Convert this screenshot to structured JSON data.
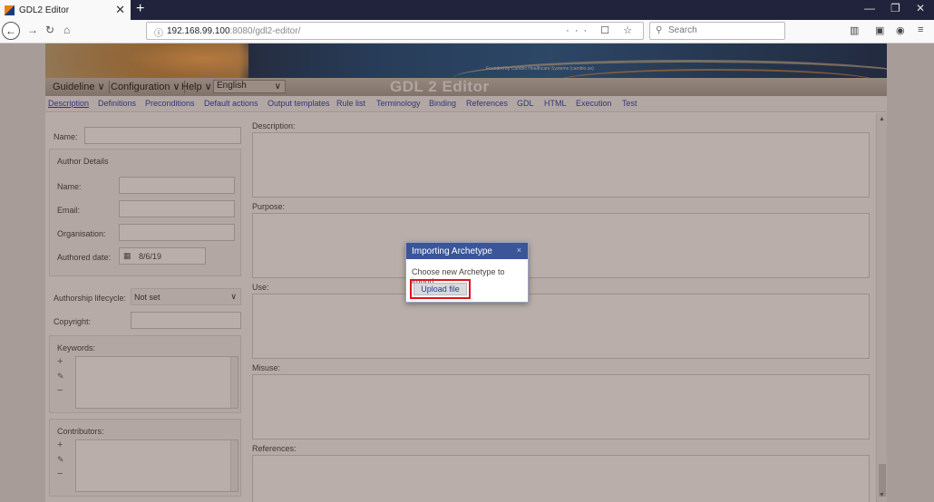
{
  "browser": {
    "tab_title": "GDL2 Editor",
    "tab_close": "✕",
    "new_tab": "+",
    "window_controls": [
      "—",
      "❐",
      "✕"
    ],
    "url_host": "192.168.99.100",
    "url_rest": ":8080/gdl2-editor/",
    "url_actions": "··· ☐ ☆",
    "search_placeholder": "Search",
    "toolbar_icons": [
      "library-icon",
      "sidebar-icon",
      "account-icon",
      "menu-icon"
    ]
  },
  "app": {
    "banner_credit": "Founded by Cambio Healthcare Systems (cambio.se)",
    "title": "GDL 2 Editor",
    "menu": [
      {
        "label": "Guideline ∨"
      },
      {
        "label": "Configuration ∨"
      },
      {
        "label": "Help ∨"
      }
    ],
    "language": "English",
    "tabs": [
      {
        "label": "Description"
      },
      {
        "label": "Definitions"
      },
      {
        "label": "Preconditions"
      },
      {
        "label": "Default actions"
      },
      {
        "label": "Output templates"
      },
      {
        "label": "Rule list"
      },
      {
        "label": "Terminology"
      },
      {
        "label": "Binding"
      },
      {
        "label": "References"
      },
      {
        "label": "GDL"
      },
      {
        "label": "HTML"
      },
      {
        "label": "Execution"
      },
      {
        "label": "Test"
      }
    ],
    "active_tab": "Description"
  },
  "left": {
    "name_label": "Name:",
    "author_details": "Author Details",
    "author_name_label": "Name:",
    "email_label": "Email:",
    "organisation_label": "Organisation:",
    "authored_date_label": "Authored date:",
    "authored_date_value": "8/6/19",
    "lifecycle_label": "Authorship lifecycle:",
    "lifecycle_value": "Not set",
    "copyright_label": "Copyright:",
    "keywords_label": "Keywords:",
    "contributors_label": "Contributors:"
  },
  "right": {
    "sections": [
      {
        "label": "Description:"
      },
      {
        "label": "Purpose:"
      },
      {
        "label": "Use:"
      },
      {
        "label": "Misuse:"
      },
      {
        "label": "References:"
      }
    ]
  },
  "modal": {
    "title": "Importing Archetype",
    "close": "×",
    "message": "Choose new Archetype to import",
    "upload_label": "Upload file",
    "highlight_color": "#e0141e"
  }
}
